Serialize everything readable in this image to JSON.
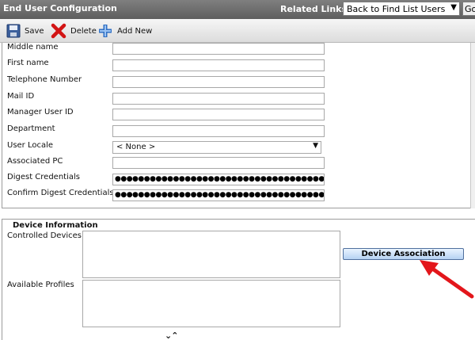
{
  "header": {
    "title": "End User Configuration",
    "related_links_label": "Related Links:",
    "related_links_value": "Back to Find List Users",
    "go_label": "Go"
  },
  "toolbar": {
    "save_label": "Save",
    "delete_label": "Delete",
    "add_new_label": "Add New",
    "icons": [
      "floppy-disk-icon",
      "red-x-delete-icon",
      "blue-plus-add-icon"
    ]
  },
  "user_info": {
    "rows": [
      {
        "label": "Middle name",
        "value": ""
      },
      {
        "label": "First name",
        "value": ""
      },
      {
        "label": "Telephone Number",
        "value": ""
      },
      {
        "label": "Mail ID",
        "value": ""
      },
      {
        "label": "Manager User ID",
        "value": ""
      },
      {
        "label": "Department",
        "value": ""
      },
      {
        "label": "User Locale",
        "value": "< None >"
      },
      {
        "label": "Associated PC",
        "value": ""
      },
      {
        "label": "Digest Credentials",
        "value": "●●●●●●●●●●●●●●●●●●●●●●●●●●●●●●●●●●●●●●●●●●●●●●●●●●●●●●"
      },
      {
        "label": "Confirm Digest Credentials",
        "value": "●●●●●●●●●●●●●●●●●●●●●●●●●●●●●●●●●●●●●●●●●●●●●●●●●●●●●●"
      }
    ]
  },
  "device_info": {
    "legend": "Device Information",
    "controlled_devices_label": "Controlled Devices",
    "available_profiles_label": "Available Profiles",
    "device_association_label": "Device Association",
    "order_arrows": "⌄⌃"
  },
  "colors": {
    "header_bg": "#6e6e6e",
    "button_blue": "#b6d2f3",
    "annotation_red": "#e3161b"
  }
}
